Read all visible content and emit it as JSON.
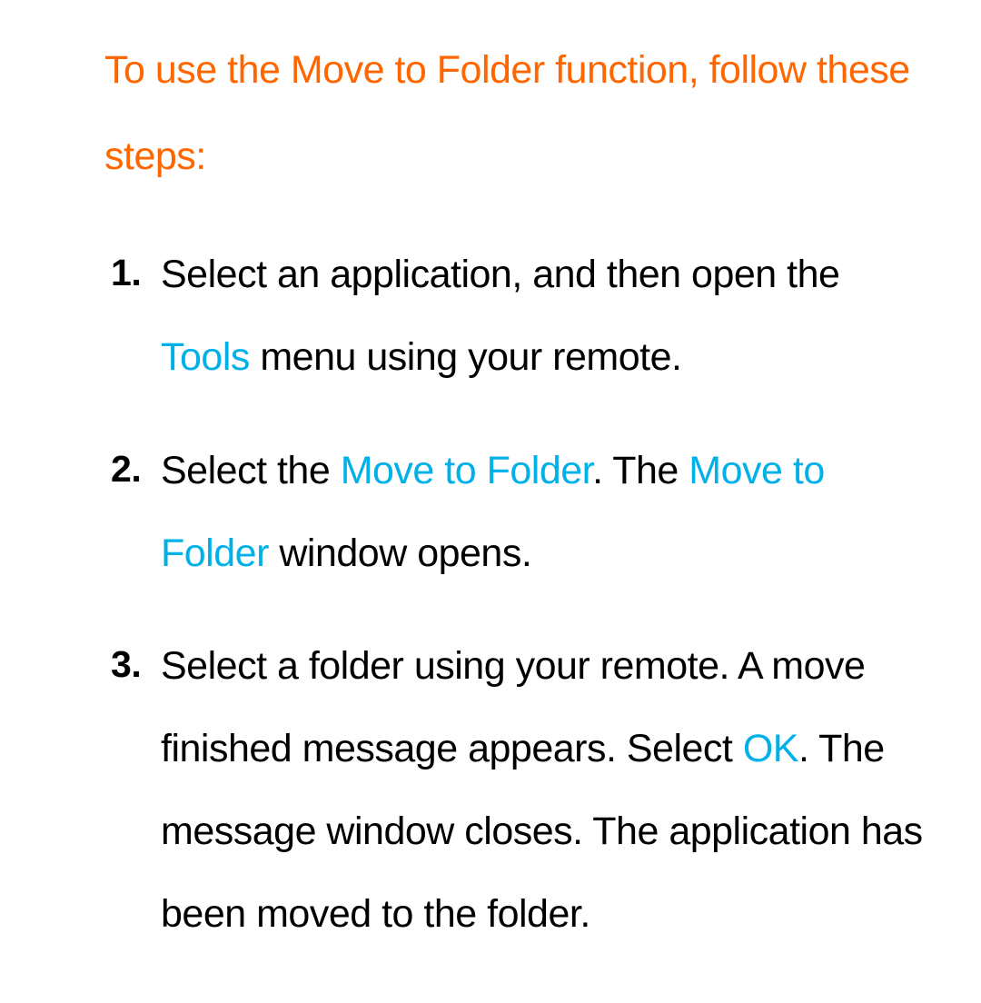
{
  "heading": "To use the Move to Folder function, follow these steps:",
  "steps": {
    "s1": {
      "part1": "Select an application, and then open the ",
      "highlight1": "Tools",
      "part2": " menu using your remote."
    },
    "s2": {
      "part1": "Select the ",
      "highlight1": "Move to Folder",
      "part2": ". The ",
      "highlight2": "Move to Folder",
      "part3": " window opens."
    },
    "s3": {
      "part1": "Select a folder using your remote. A move finished message appears. Select ",
      "highlight1": "OK",
      "part2": ". The message window closes. The application has been moved to the folder."
    }
  }
}
